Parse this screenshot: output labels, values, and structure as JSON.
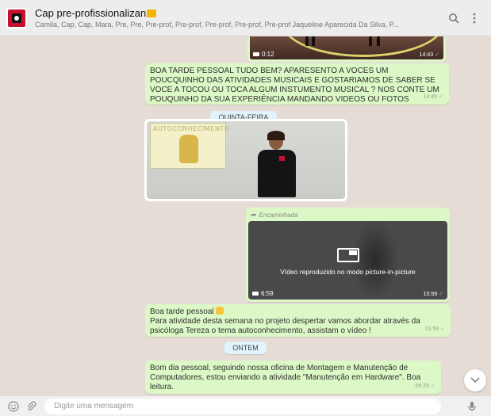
{
  "header": {
    "title": "Cap pre-profissionalizan",
    "subtitle": "Camila, Cap, Cap, Mara, Pre, Pre, Pre-prof, Pre-prof, Pre-prof, Pre-prof, Pre-prof Jaqueline Aparecida Da Silva, P...",
    "icons": [
      "group-avatar",
      "folder-emoji-icon",
      "search-icon",
      "menu-icon"
    ]
  },
  "video_top": {
    "duration": "0:12",
    "time": "14:43"
  },
  "message1": {
    "text": "BOA TARDE PESSOAL TUDO BEM? APARESENTO A VOCES UM POUCQUINHO DAS ATIVIDADES MUSICAIS E GOSTARIAMOS DE SABER SE VOCE A TOCOU OU TOCA ALGUM INSTUMENTO MUSICAL ? NOS CONTE UM POUQUINHO DA SUA EXPERIÊNCIA MANDANDO VIDEOS OU FOTOS",
    "time": "14:45"
  },
  "day1": "QUINTA-FEIRA",
  "photo": {
    "poster_text": "AUTOCONHECIMENTO"
  },
  "forwarded": {
    "label": "Encaminhada",
    "pip_text": "Vídeo reproduzido no modo picture-in-picture",
    "duration": "6:59",
    "time": "15:59"
  },
  "message2": {
    "line1": "Boa tarde pessoal",
    "body": "Para atividade desta semana no projeto despertar vamos abordar através da psicóloga Tereza o tema autoconhecimento, assistam o vídeo !",
    "time": "15:59"
  },
  "day2": "ONTEM",
  "message3": {
    "text": "Bom dia pessoal, seguindo nossa oficina de Montagem e Manutenção de Computadores, estou enviando a atividade \"Manutenção em Hardware\". Boa leitura.",
    "time": "09:25"
  },
  "composer": {
    "placeholder": "Digite uma mensagem"
  },
  "colors": {
    "outgoing": "#dcf8c6",
    "chat_bg": "#e5ddd5",
    "header_bg": "#ededed"
  }
}
